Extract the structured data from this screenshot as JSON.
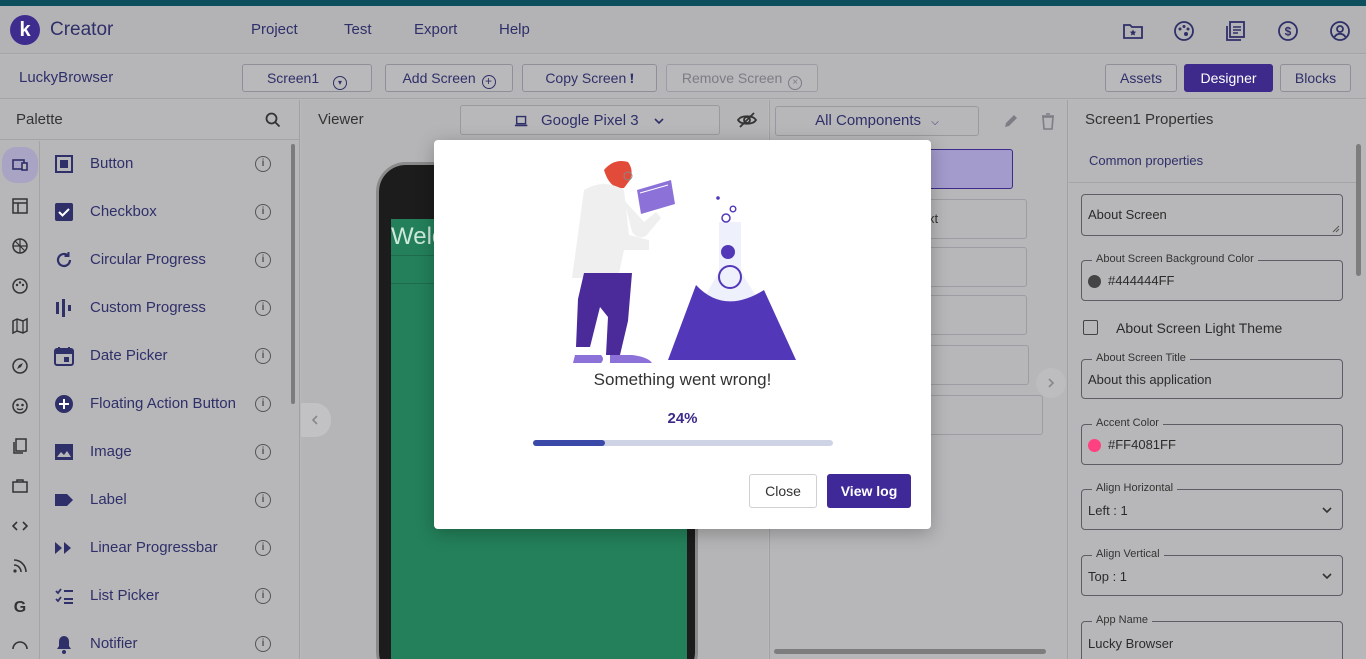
{
  "header": {
    "logo_letter": "k",
    "brand": "Creator",
    "menu": [
      "Project",
      "Test",
      "Export",
      "Help"
    ]
  },
  "toolbar": {
    "project_name": "LuckyBrowser",
    "screen_select": "Screen1",
    "add_screen": "Add Screen",
    "copy_screen": "Copy Screen",
    "remove_screen": "Remove Screen",
    "assets": "Assets",
    "designer": "Designer",
    "blocks": "Blocks"
  },
  "palette": {
    "title": "Palette",
    "items": [
      {
        "label": "Button",
        "icon": "button-icon"
      },
      {
        "label": "Checkbox",
        "icon": "checkbox-icon"
      },
      {
        "label": "Circular Progress",
        "icon": "circular-progress-icon"
      },
      {
        "label": "Custom Progress",
        "icon": "custom-progress-icon"
      },
      {
        "label": "Date Picker",
        "icon": "date-picker-icon"
      },
      {
        "label": "Floating Action Button",
        "icon": "fab-icon"
      },
      {
        "label": "Image",
        "icon": "image-icon"
      },
      {
        "label": "Label",
        "icon": "label-icon"
      },
      {
        "label": "Linear Progressbar",
        "icon": "linear-progress-icon"
      },
      {
        "label": "List Picker",
        "icon": "list-picker-icon"
      },
      {
        "label": "Notifier",
        "icon": "notifier-icon"
      }
    ],
    "info_glyph": "i"
  },
  "viewer": {
    "title": "Viewer",
    "device": "Google Pixel 3",
    "screen_text": "Welc"
  },
  "tree": {
    "filter": "All Components",
    "partial_label": "xt"
  },
  "properties": {
    "title": "Screen1 Properties",
    "tab": "Common properties",
    "about_screen": "About Screen",
    "bg_color_label": "About Screen Background Color",
    "bg_color_value": "#444444FF",
    "bg_color_swatch": "#444444",
    "light_theme_label": "About Screen Light Theme",
    "about_title_label": "About Screen Title",
    "about_title_value": "About this application",
    "accent_label": "Accent Color",
    "accent_value": "#FF4081FF",
    "accent_swatch": "#FF4081",
    "align_h_label": "Align Horizontal",
    "align_h_value": "Left : 1",
    "align_v_label": "Align Vertical",
    "align_v_value": "Top : 1",
    "app_name_label": "App Name",
    "app_name_value": "Lucky Browser"
  },
  "modal": {
    "message": "Something went wrong!",
    "percent_text": "24%",
    "progress": 0.24,
    "close": "Close",
    "view_log": "View log"
  }
}
